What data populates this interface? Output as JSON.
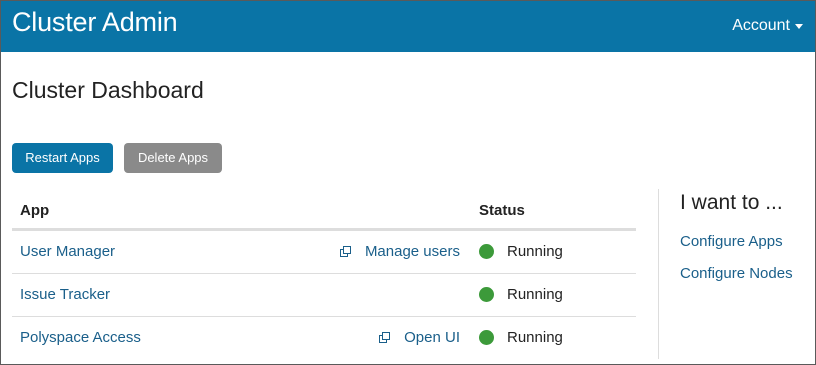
{
  "header": {
    "brand": "Cluster Admin",
    "account_label": "Account"
  },
  "page": {
    "title": "Cluster Dashboard"
  },
  "actions": {
    "restart_label": "Restart Apps",
    "delete_label": "Delete Apps"
  },
  "table": {
    "columns": [
      "App",
      "Status"
    ],
    "rows": [
      {
        "app": "User Manager",
        "link": "Manage users",
        "status": "Running"
      },
      {
        "app": "Issue Tracker",
        "link": "",
        "status": "Running"
      },
      {
        "app": "Polyspace Access",
        "link": "Open UI",
        "status": "Running"
      }
    ]
  },
  "sidebar": {
    "title": "I want to ...",
    "links": [
      "Configure Apps",
      "Configure Nodes"
    ]
  },
  "colors": {
    "brand": "#0a74a6",
    "secondary_button": "#8a8a8a",
    "link": "#1a5f8a",
    "status_running": "#3c9a3a"
  },
  "icons": {
    "account_caret": "caret-down-icon",
    "external_link": "external-link-icon",
    "status": "status-dot-icon"
  }
}
